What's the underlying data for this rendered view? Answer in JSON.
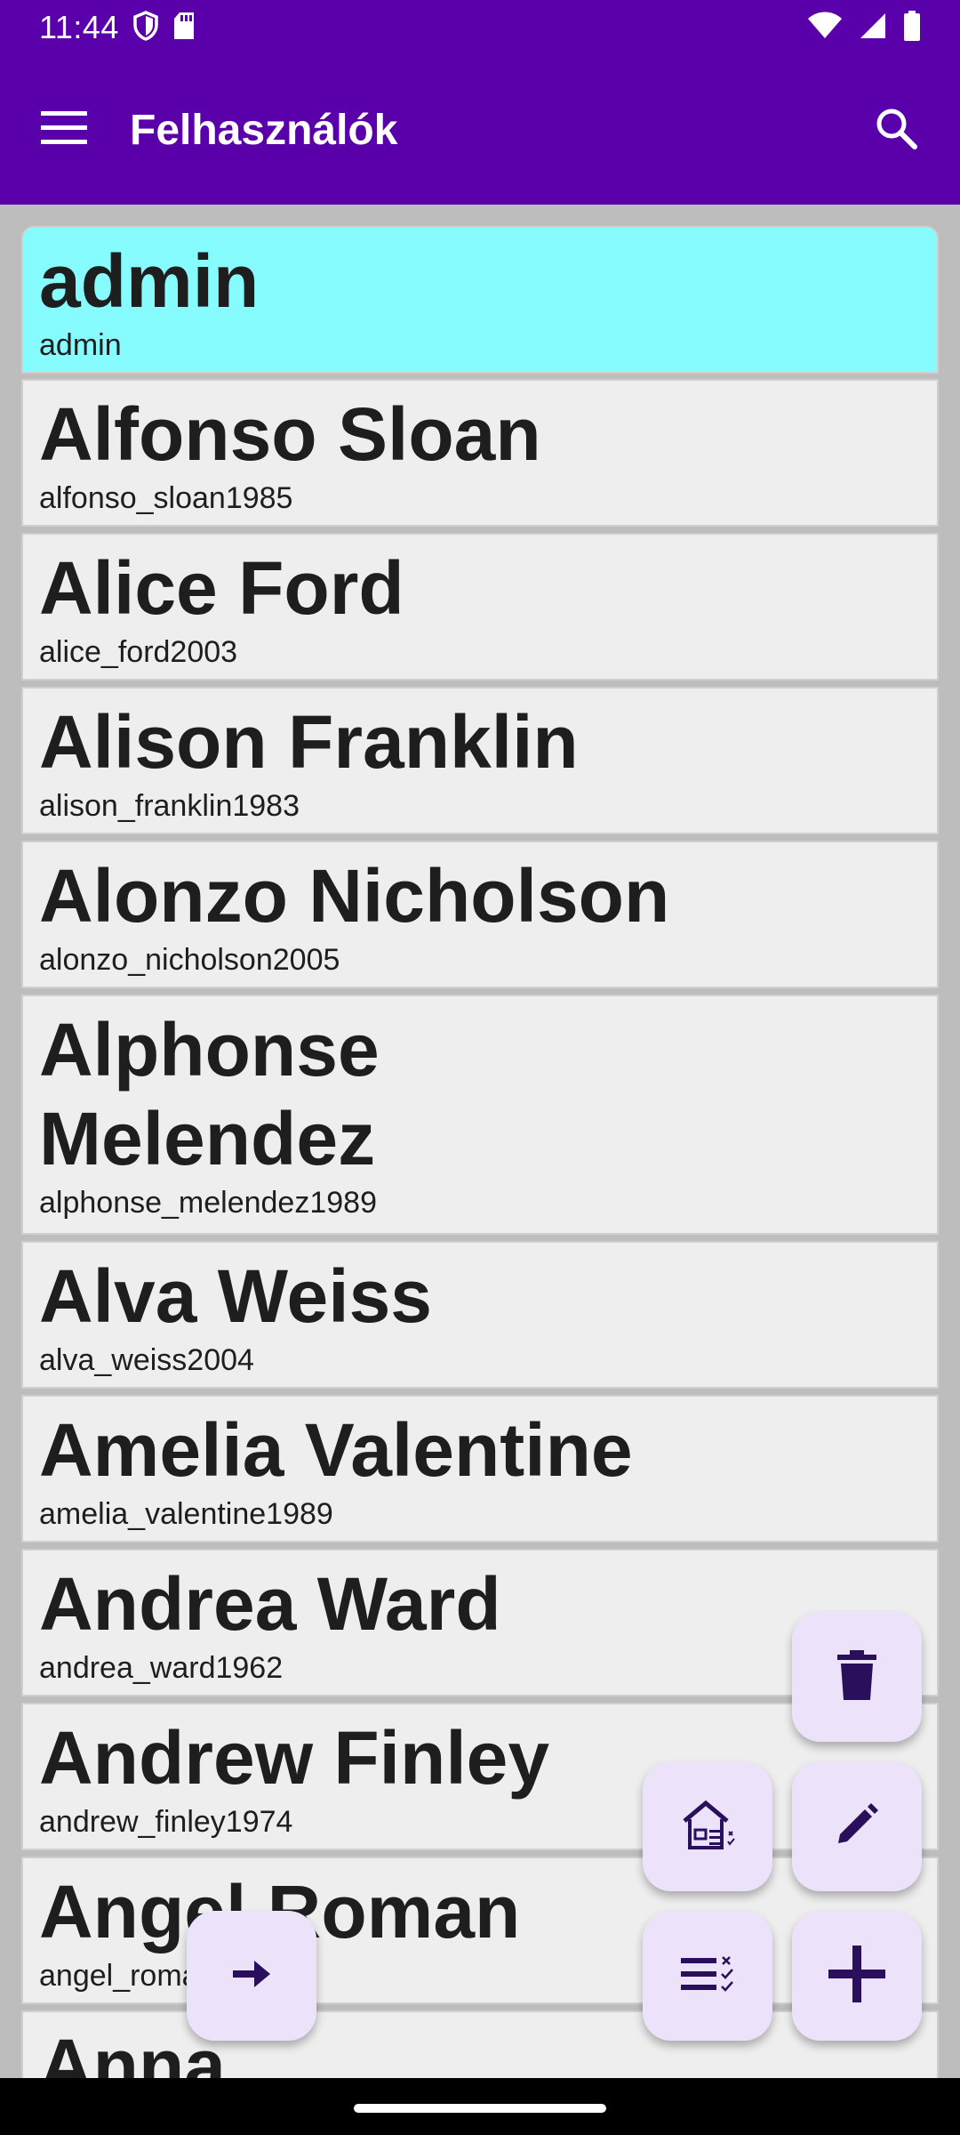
{
  "status_bar": {
    "time": "11:44",
    "icons": [
      "shield-icon",
      "sd-card-icon",
      "wifi-icon",
      "cellular-signal-icon",
      "battery-icon"
    ]
  },
  "app_bar": {
    "title": "Felhasználók",
    "menu_icon": "menu-icon",
    "search_icon": "search-icon"
  },
  "colors": {
    "primary": "#5a00aa",
    "selected_row": "#87fcff",
    "row_bg": "#eeeeee",
    "fab_bg": "#ece3fb",
    "fab_icon": "#2a0f5c"
  },
  "users": [
    {
      "name": "admin",
      "username": "admin",
      "selected": true
    },
    {
      "name": "Alfonso Sloan",
      "username": "alfonso_sloan1985"
    },
    {
      "name": "Alice Ford",
      "username": "alice_ford2003"
    },
    {
      "name": "Alison Franklin",
      "username": "alison_franklin1983"
    },
    {
      "name": "Alonzo Nicholson",
      "username": "alonzo_nicholson2005"
    },
    {
      "name": "Alphonse Melendez",
      "username": "alphonse_melendez1989"
    },
    {
      "name": "Alva Weiss",
      "username": "alva_weiss2004"
    },
    {
      "name": "Amelia Valentine",
      "username": "amelia_valentine1989"
    },
    {
      "name": "Andrea Ward",
      "username": "andrea_ward1962"
    },
    {
      "name": "Andrew Finley",
      "username": "andrew_finley1974"
    },
    {
      "name": "Angel Roman",
      "username": "angel_roman"
    },
    {
      "name": "Anna",
      "username": ""
    }
  ],
  "fabs": [
    {
      "name": "delete-button",
      "icon": "trash-icon"
    },
    {
      "name": "edit-button",
      "icon": "pencil-icon"
    },
    {
      "name": "house-list-button",
      "icon": "house-list-icon"
    },
    {
      "name": "checklist-button",
      "icon": "checklist-icon"
    },
    {
      "name": "add-button",
      "icon": "plus-icon"
    },
    {
      "name": "forward-button",
      "icon": "arrow-right-icon"
    }
  ]
}
